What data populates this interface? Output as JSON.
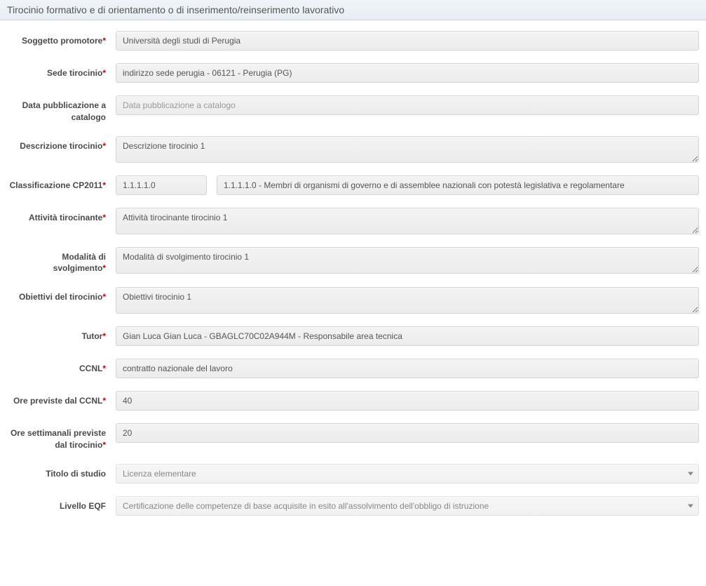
{
  "header": {
    "title": "Tirocinio formativo e di orientamento o di inserimento/reinserimento lavorativo"
  },
  "labels": {
    "soggetto_promotore": "Soggetto promotore",
    "sede_tirocinio": "Sede tirocinio",
    "data_pubblicazione": "Data pubblicazione a catalogo",
    "descrizione_tirocinio": "Descrizione tirocinio",
    "classificazione_cp2011": "Classificazione CP2011",
    "attivita_tirocinante": "Attività tirocinante",
    "modalita_svolgimento": "Modalità di svolgimento",
    "obiettivi_tirocinio": "Obiettivi del tirocinio",
    "tutor": "Tutor",
    "ccnl": "CCNL",
    "ore_ccnl": "Ore previste dal CCNL",
    "ore_settimanali": "Ore settimanali previste dal tirocinio",
    "titolo_studio": "Titolo di studio",
    "livello_eqf": "Livello EQF"
  },
  "values": {
    "soggetto_promotore": "Università degli studi di Perugia",
    "sede_tirocinio": "indirizzo sede perugia - 06121 - Perugia (PG)",
    "data_pubblicazione": "",
    "data_pubblicazione_placeholder": "Data pubblicazione a catalogo",
    "descrizione_tirocinio": "Descrizione tirocinio 1",
    "cp2011_code": "1.1.1.1.0",
    "cp2011_desc": "1.1.1.1.0 - Membri di organismi di governo e di assemblee nazionali con potestà legislativa e regolamentare",
    "attivita_tirocinante": "Attività tirocinante tirocinio 1",
    "modalita_svolgimento": "Modalità di svolgimento tirocinio 1",
    "obiettivi_tirocinio": "Obiettivi tirocinio 1",
    "tutor": "Gian Luca Gian Luca - GBAGLC70C02A944M - Responsabile area tecnica",
    "ccnl": "contratto nazionale del lavoro",
    "ore_ccnl": "40",
    "ore_settimanali": "20",
    "titolo_studio": "Licenza elementare",
    "livello_eqf": "Certificazione delle competenze di base acquisite in esito all'assolvimento dell'obbligo di istruzione"
  }
}
